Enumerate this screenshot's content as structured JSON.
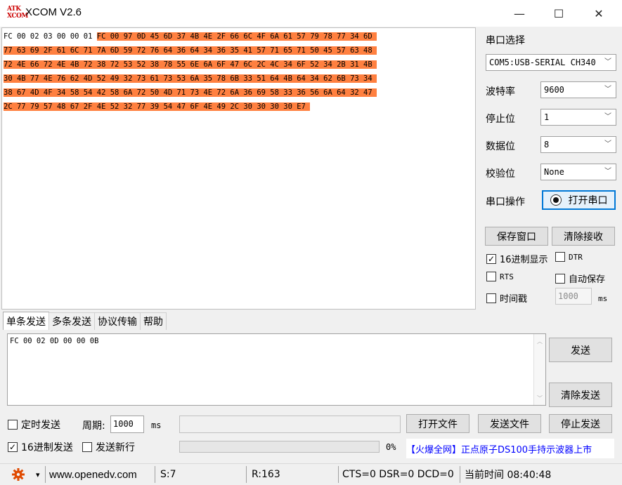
{
  "window": {
    "title": "XCOM V2.6",
    "logo_line1": "ATK",
    "logo_line2": "XCOM",
    "minimize_glyph": "—",
    "maximize_glyph": "☐",
    "close_glyph": "✕"
  },
  "receive": {
    "sent_prefix": "FC 00 02 03 00 00 01",
    "lines": [
      "FC 00 97 0D 45 6D 37 4B 4E 2F 66 6C 4F 6A 61 57 79 78 77 34 6D",
      "77 63 69 2F 61 6C 71 7A 6D 59 72 76 64 36 64 34 36 35 41 57 71 65 71 50 45 57 63 48",
      "72 4E 66 72 4E 4B 72 38 72 53 52 38 78 55 6E 6A 6F 47 6C 2C 4C 34 6F 52 34 2B 31 4B",
      "30 4B 77 4E 76 62 4D 52 49 32 73 61 73 53 6A 35 78 6B 33 51 64 4B 64 34 62 6B 73 34",
      "38 67 4D 4F 34 58 54 42 58 6A 72 50 4D 71 73 4E 72 6A 36 69 58 33 36 56 6A 64 32 47",
      "2C 77 79 57 48 67 2F 4E 52 32 77 39 54 47 6F 4E 49 2C 30 30 30 30 E7"
    ],
    "highlight_color": "#ff8040"
  },
  "settings": {
    "port_select_label": "串口选择",
    "port_value": "COM5:USB-SERIAL CH340",
    "baud_label": "波特率",
    "baud_value": "9600",
    "stopbits_label": "停止位",
    "stopbits_value": "1",
    "databits_label": "数据位",
    "databits_value": "8",
    "parity_label": "校验位",
    "parity_value": "None",
    "port_op_label": "串口操作",
    "open_port_button": "打开串口",
    "save_window_button": "保存窗口",
    "clear_receive_button": "清除接收",
    "hex_display_label": "16进制显示",
    "hex_display_checked": true,
    "dtr_label": "DTR",
    "dtr_checked": false,
    "rts_label": "RTS",
    "rts_checked": false,
    "autosave_label": "自动保存",
    "autosave_checked": false,
    "timestamp_label": "时间戳",
    "timestamp_checked": false,
    "timestamp_interval": "1000",
    "timestamp_unit": "ms"
  },
  "tabs": [
    "单条发送",
    "多条发送",
    "协议传输",
    "帮助"
  ],
  "send": {
    "text": "FC 00 02 0D 00 00 0B",
    "send_button": "发送",
    "clear_send_button": "清除发送",
    "timed_send_label": "定时发送",
    "timed_send_checked": false,
    "period_label": "周期:",
    "period_value": "1000",
    "period_unit": "ms",
    "file_path": "",
    "open_file_button": "打开文件",
    "send_file_button": "发送文件",
    "stop_send_button": "停止发送",
    "hex_send_label": "16进制发送",
    "hex_send_checked": true,
    "send_newline_label": "发送新行",
    "send_newline_checked": false,
    "progress_text": "0%",
    "progress_value": 0,
    "ad_text": "【火爆全网】正点原子DS100手持示波器上市"
  },
  "status": {
    "gear_icon_color": "#e04a00",
    "dropdown_glyph": "▾",
    "website": "www.openedv.com",
    "sent": "S:7",
    "received": "R:163",
    "lines": "CTS=0 DSR=0 DCD=0",
    "time": "当前时间 08:40:48"
  }
}
